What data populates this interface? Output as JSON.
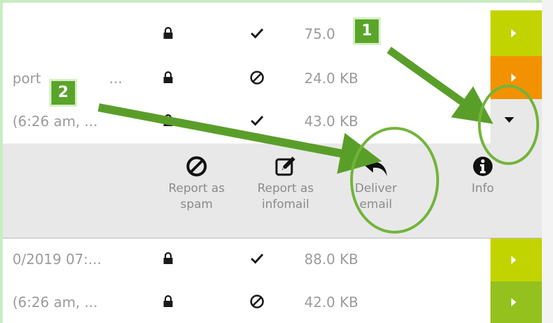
{
  "rows": [
    {
      "subject": "",
      "status": "check",
      "size": "75.0",
      "action_color": "#c2d400"
    },
    {
      "subject": "port",
      "subject2": "...",
      "status": "blocked",
      "size": "24.0 KB",
      "action_color": "#f39200"
    },
    {
      "subject": "(6:26 am, ...",
      "status": "check",
      "size": "43.0 KB",
      "action": "dropdown"
    },
    {
      "subject": "0/2019 07:...",
      "status": "check",
      "size": "88.0 KB",
      "action_color": "#c2d400"
    },
    {
      "subject": "(6:26 am, ...",
      "status": "blocked",
      "size": "42.0 KB",
      "action_color": "#95c11f"
    }
  ],
  "menu": {
    "report_spam": [
      "Report as",
      "spam"
    ],
    "report_infomail": [
      "Report as",
      "infomail"
    ],
    "deliver": [
      "Deliver",
      "email"
    ],
    "info": [
      "Info"
    ]
  },
  "callouts": {
    "one": "1",
    "two": "2"
  },
  "colors": {
    "callout": "#5aa42a",
    "arrow": "#5a9e2a",
    "circle": "#72b43a"
  }
}
